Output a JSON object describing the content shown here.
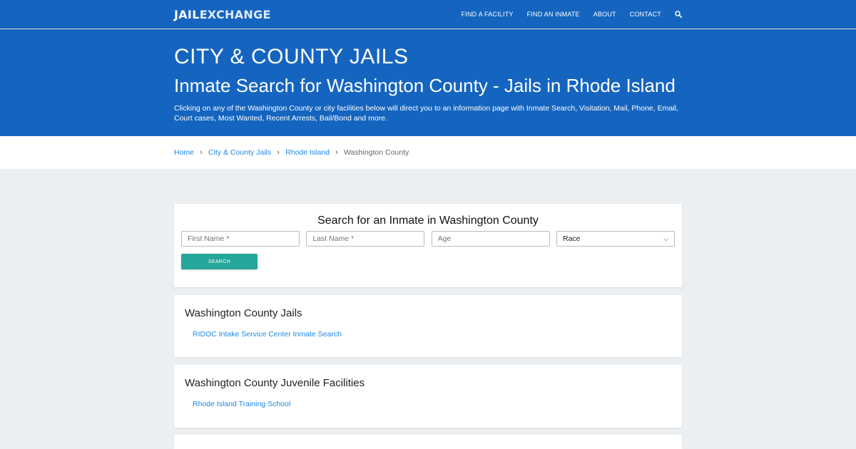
{
  "brand": {
    "logo_part1": "JAIL",
    "logo_part2": "EXCHANGE"
  },
  "nav": {
    "items": [
      {
        "label": "FIND A FACILITY"
      },
      {
        "label": "FIND AN INMATE"
      },
      {
        "label": "ABOUT"
      },
      {
        "label": "CONTACT"
      }
    ],
    "search_icon": "search-icon"
  },
  "hero": {
    "title": "CITY & COUNTY JAILS",
    "subtitle": "Inmate Search for Washington County - Jails in Rhode Island",
    "description": "Clicking on any of the Washington County or city facilities below will direct you to an information page with Inmate Search, Visitation, Mail, Phone, Email, Court cases, Most Wanted, Recent Arrests, Bail/Bond and more."
  },
  "breadcrumb": {
    "items": [
      "Home",
      "City & County Jails",
      "Rhode Island"
    ],
    "current": "Washington County"
  },
  "search_form": {
    "title": "Search for an Inmate in Washington County",
    "first_name_placeholder": "First Name *",
    "last_name_placeholder": "Last Name *",
    "age_placeholder": "Age",
    "race_selected": "Race",
    "button_label": "SEARCH"
  },
  "sections": [
    {
      "heading": "Washington County Jails",
      "links": [
        "RIDOC Intake Service Center Inmate Search"
      ]
    },
    {
      "heading": "Washington County Juvenile Facilities",
      "links": [
        "Rhode Island Training School"
      ]
    }
  ],
  "colors": {
    "primary_blue": "#1565c0",
    "link_blue": "#1e88e5",
    "button_teal": "#26a69a",
    "page_bg": "#eceff1"
  }
}
